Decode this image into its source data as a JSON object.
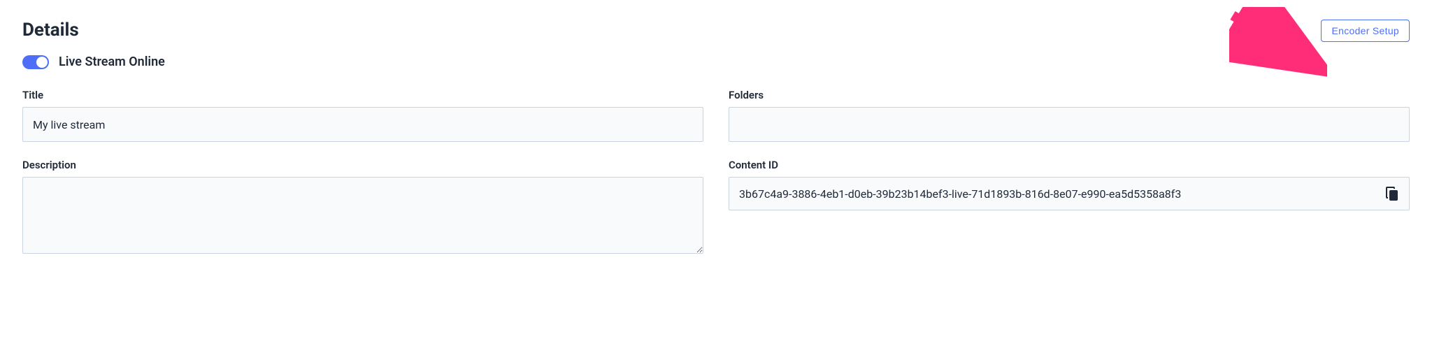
{
  "header": {
    "title": "Details",
    "encoder_button": "Encoder Setup"
  },
  "toggle": {
    "label": "Live Stream Online",
    "on": true
  },
  "fields": {
    "title_label": "Title",
    "title_value": "My live stream",
    "folders_label": "Folders",
    "folders_value": "",
    "description_label": "Description",
    "description_value": "",
    "content_id_label": "Content ID",
    "content_id_value": "3b67c4a9-3886-4eb1-d0eb-39b23b14bef3-live-71d1893b-816d-8e07-e990-ea5d5358a8f3"
  }
}
